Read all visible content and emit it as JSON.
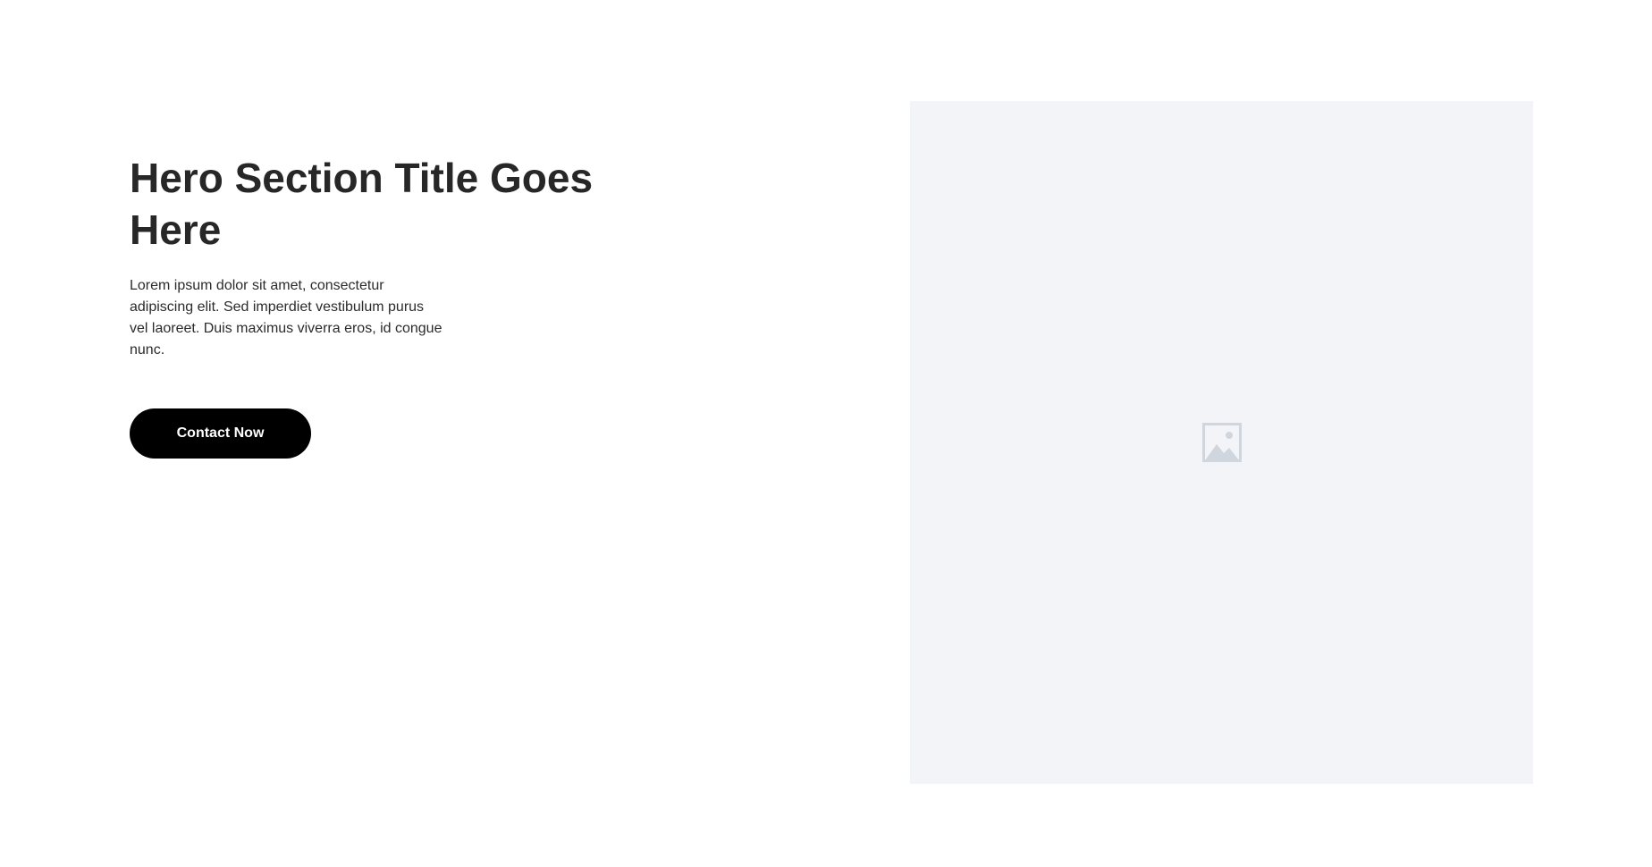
{
  "hero": {
    "title": "Hero Section Title Goes Here",
    "description": "Lorem ipsum dolor sit amet, consectetur adipiscing elit. Sed imperdiet vestibulum purus vel laoreet. Duis maximus viverra eros, id congue nunc.",
    "cta_label": "Contact Now"
  },
  "media": {
    "icon": "image-placeholder-icon"
  },
  "colors": {
    "background": "#ffffff",
    "title": "#272727",
    "text": "#2b2b2b",
    "button_bg": "#000000",
    "button_text": "#ffffff",
    "media_bg": "#f3f4f8",
    "placeholder_icon": "#cfd6de"
  }
}
